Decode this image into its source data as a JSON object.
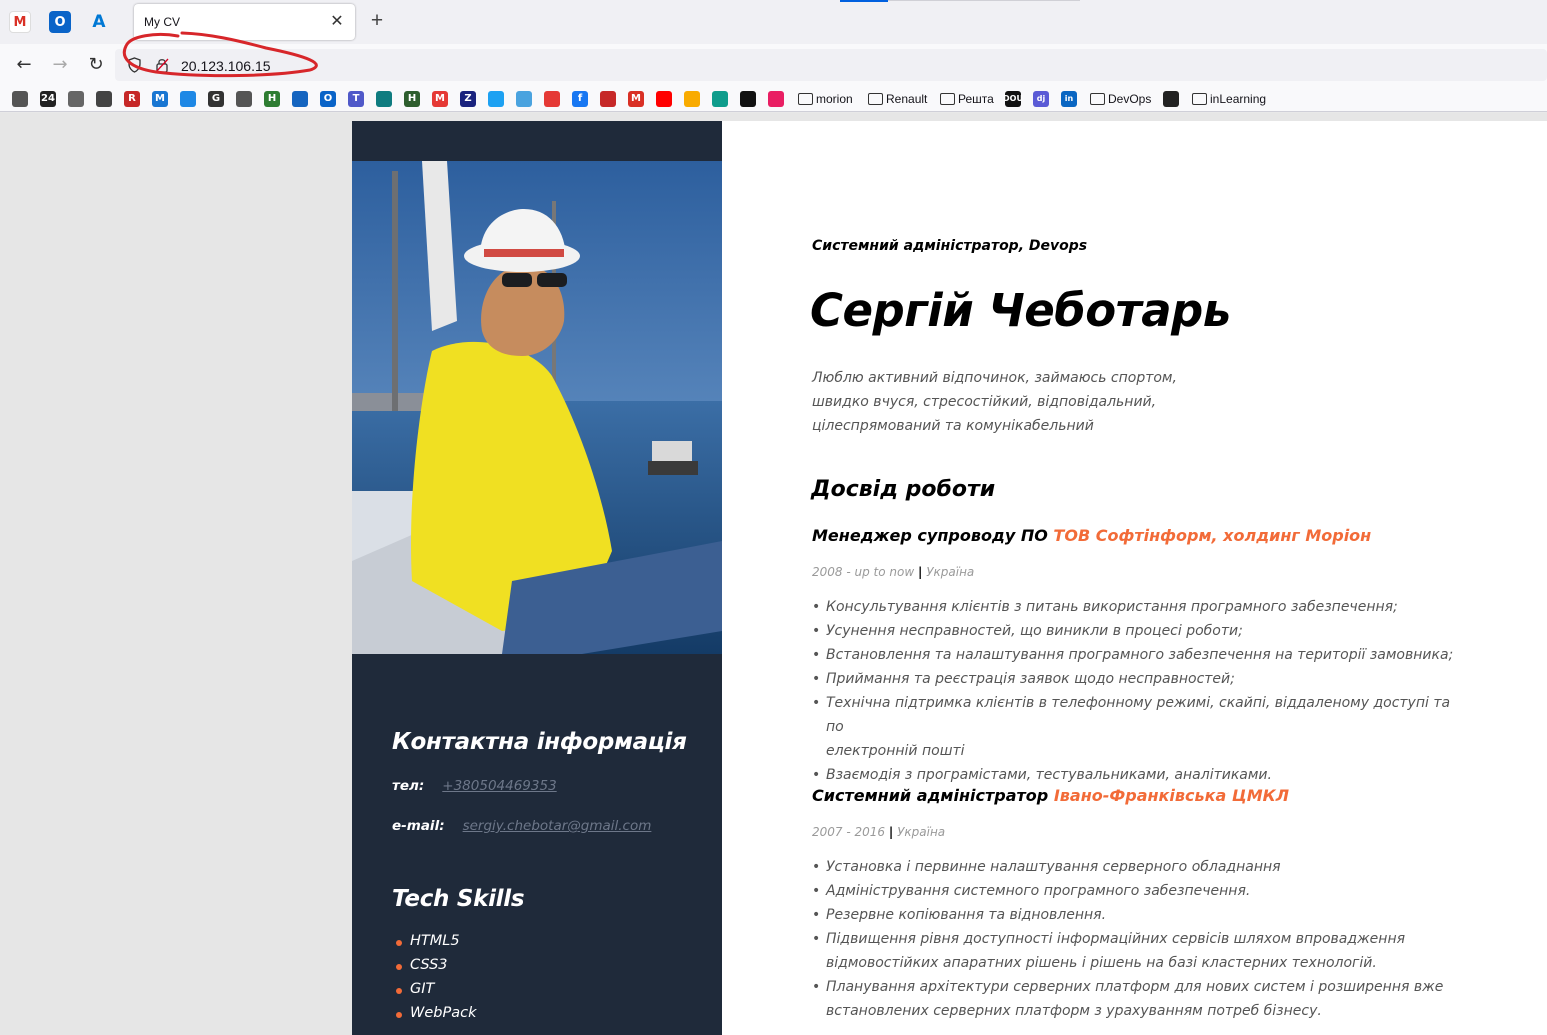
{
  "browser": {
    "pinned_tabs": [
      "gmail-icon",
      "outlook-icon",
      "azure-icon"
    ],
    "active_tab_title": "My CV",
    "new_tab_label": "+",
    "close_tab_label": "✕",
    "url": "20.123.106.15",
    "bookmarks": [
      {
        "icon": "globe-icon"
      },
      {
        "icon": "24-icon",
        "text": "24"
      },
      {
        "icon": "folder-icon"
      },
      {
        "icon": "bottle-icon"
      },
      {
        "icon": "r-icon",
        "text": "R"
      },
      {
        "icon": "m-icon",
        "text": "M"
      },
      {
        "icon": "jira-icon"
      },
      {
        "icon": "g-icon",
        "text": "G"
      },
      {
        "icon": "globe-icon"
      },
      {
        "icon": "h-icon",
        "text": "H"
      },
      {
        "icon": "trello-icon"
      },
      {
        "icon": "outlook-icon",
        "text": "O"
      },
      {
        "icon": "teams-icon",
        "text": "T"
      },
      {
        "icon": "edge-icon"
      },
      {
        "icon": "h2-icon",
        "text": "H"
      },
      {
        "icon": "m2-icon",
        "text": "M"
      },
      {
        "icon": "z-icon",
        "text": "Z"
      },
      {
        "icon": "twitter-icon"
      },
      {
        "icon": "star-icon"
      },
      {
        "icon": "mail-icon"
      },
      {
        "icon": "facebook-icon",
        "text": "f"
      },
      {
        "icon": "thermometer-icon"
      },
      {
        "icon": "gmail-icon",
        "text": "M"
      },
      {
        "icon": "youtube-icon"
      },
      {
        "icon": "keep-icon"
      },
      {
        "icon": "olx-icon"
      },
      {
        "icon": "square-icon"
      },
      {
        "icon": "bracket-icon"
      }
    ],
    "bookmark_folders": [
      {
        "label": "morion"
      },
      {
        "label": "Renault"
      },
      {
        "label": "Решта"
      },
      {
        "label": "DevOps"
      },
      {
        "label": "inLearning"
      }
    ],
    "dou_label": "DOU",
    "dj_label": "dj",
    "in_label": "in"
  },
  "accent_color": "#f26b38",
  "sidebar_color": "#1f2a3a",
  "cv": {
    "role": "Системний адміністратор, Devops",
    "name": "Сергій Чеботарь",
    "about": [
      "Люблю активний відпочинок, займаюсь спортом,",
      "швидко вчуся, стресостійкий, відповідальний,",
      "цілеспрямований та комунікабельний"
    ],
    "experience_heading": "Досвід роботи",
    "jobs": [
      {
        "title": "Менеджер супроводу ПО",
        "org": "ТОВ Софтінформ, холдинг Моріон",
        "period": "2008 - up to now",
        "country": "Україна",
        "duties": [
          "Консультування клієнтів з питань використання програмного забезпечення;",
          "Усунення несправностей, що виникли в процесі роботи;",
          "Встановлення та налаштування програмного забезпечення на території замовника;",
          "Приймання та реєстрація заявок щодо несправностей;",
          "Технічна підтримка клієнтів в телефонному режимі, скайпі, віддаленому доступі та по",
          "електронній пошті",
          "Взаємодія з програмістами, тестувальниками, аналітиками."
        ]
      },
      {
        "title": "Системний адміністратор",
        "org": "Івано-Франківська ЦМКЛ",
        "period": "2007 - 2016",
        "country": "Україна",
        "duties": [
          "Установка і первинне налаштування серверного обладнання",
          "Адміністрування системного програмного забезпечення.",
          "Резервне копіювання та відновлення.",
          "Підвищення рівня доступності інформаційних сервісів шляхом впровадження",
          "відмовостійких апаратних рішень і рішень на базі кластерних технологій.",
          "Планування архітектури серверних платформ для нових систем і розширення вже",
          "встановлених серверних платформ з урахуванням потреб бізнесу."
        ]
      }
    ],
    "contact_heading": "Контактна інформація",
    "phone_label": "тел:",
    "phone": "+380504469353",
    "email_label": "e-mail:",
    "email": "sergiy.chebotar@gmail.com",
    "skills_heading": "Tech Skills",
    "skills": [
      "HTML5",
      "CSS3",
      "GIT",
      "WebPack"
    ]
  }
}
